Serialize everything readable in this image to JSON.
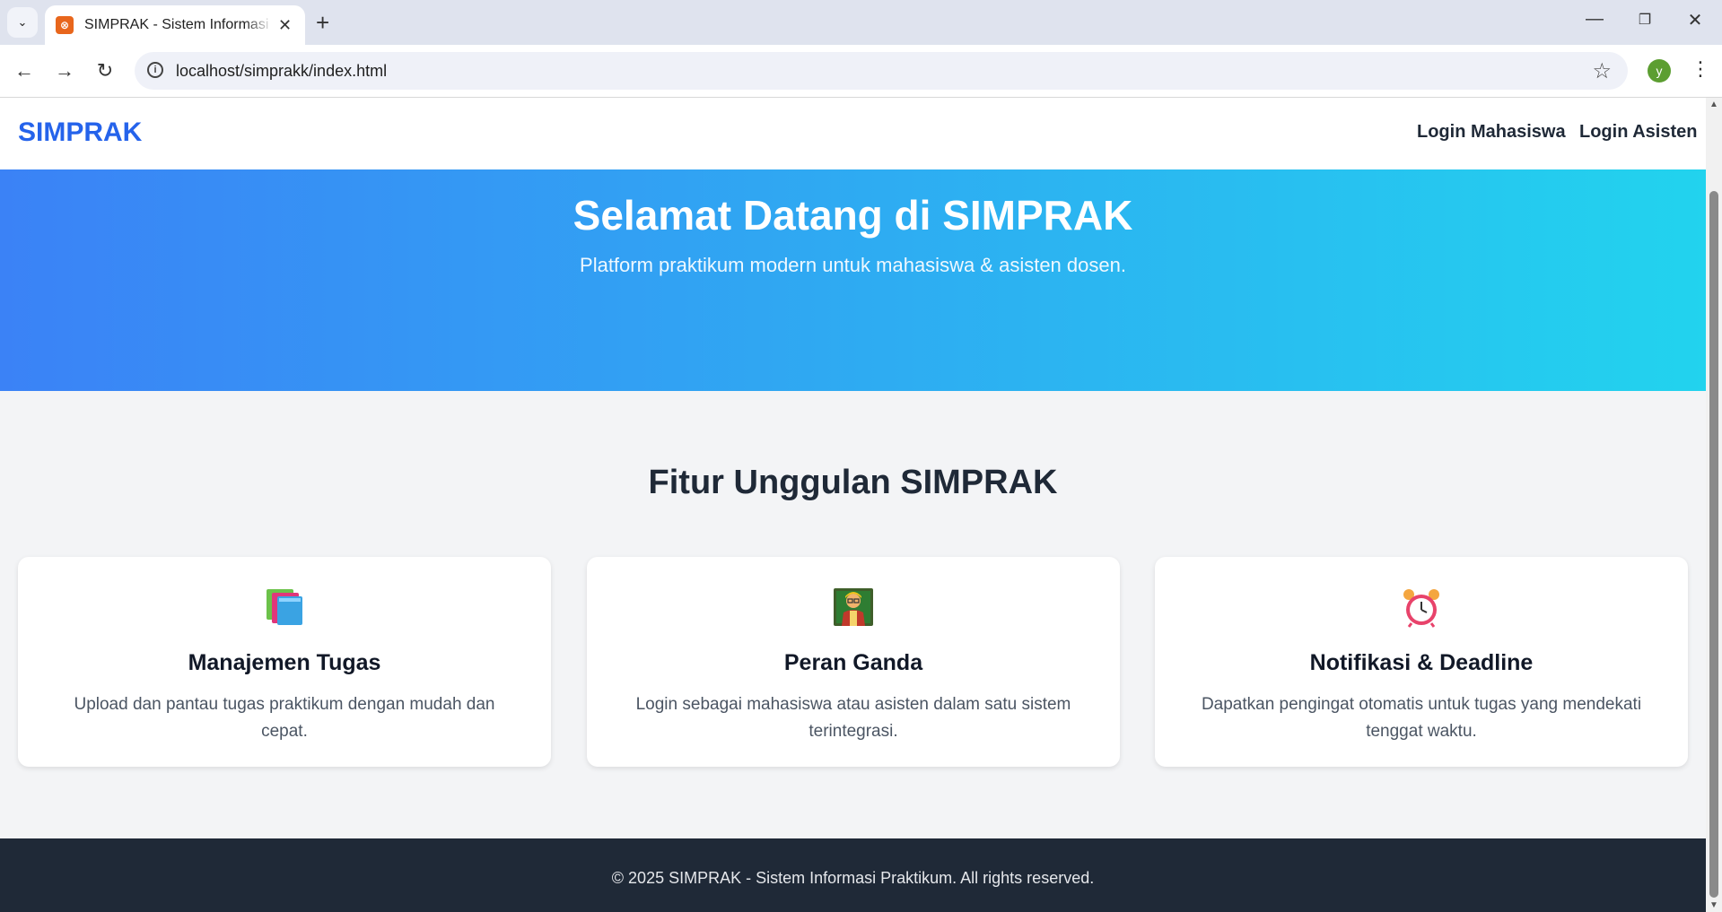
{
  "browser": {
    "tab_title": "SIMPRAK - Sistem Informasi Praktikum",
    "url": "localhost/simprakk/index.html",
    "profile_initial": "y"
  },
  "site": {
    "brand": "SIMPRAK",
    "nav": [
      "Login Mahasiswa",
      "Login Asisten"
    ]
  },
  "hero": {
    "title": "Selamat Datang di SIMPRAK",
    "subtitle": "Platform praktikum modern untuk mahasiswa & asisten dosen."
  },
  "features": {
    "title": "Fitur Unggulan SIMPRAK",
    "cards": [
      {
        "icon": "books-icon",
        "title": "Manajemen Tugas",
        "desc": "Upload dan pantau tugas praktikum dengan mudah dan cepat."
      },
      {
        "icon": "teacher-icon",
        "title": "Peran Ganda",
        "desc": "Login sebagai mahasiswa atau asisten dalam satu sistem terintegrasi."
      },
      {
        "icon": "alarm-clock-icon",
        "title": "Notifikasi & Deadline",
        "desc": "Dapatkan pengingat otomatis untuk tugas yang mendekati tenggat waktu."
      }
    ]
  },
  "footer": {
    "text": "© 2025 SIMPRAK - Sistem Informasi Praktikum. All rights reserved."
  },
  "colors": {
    "brand": "#2563eb",
    "hero_start": "#3b82f6",
    "hero_end": "#22d3ee",
    "footer_bg": "#1f2937"
  }
}
